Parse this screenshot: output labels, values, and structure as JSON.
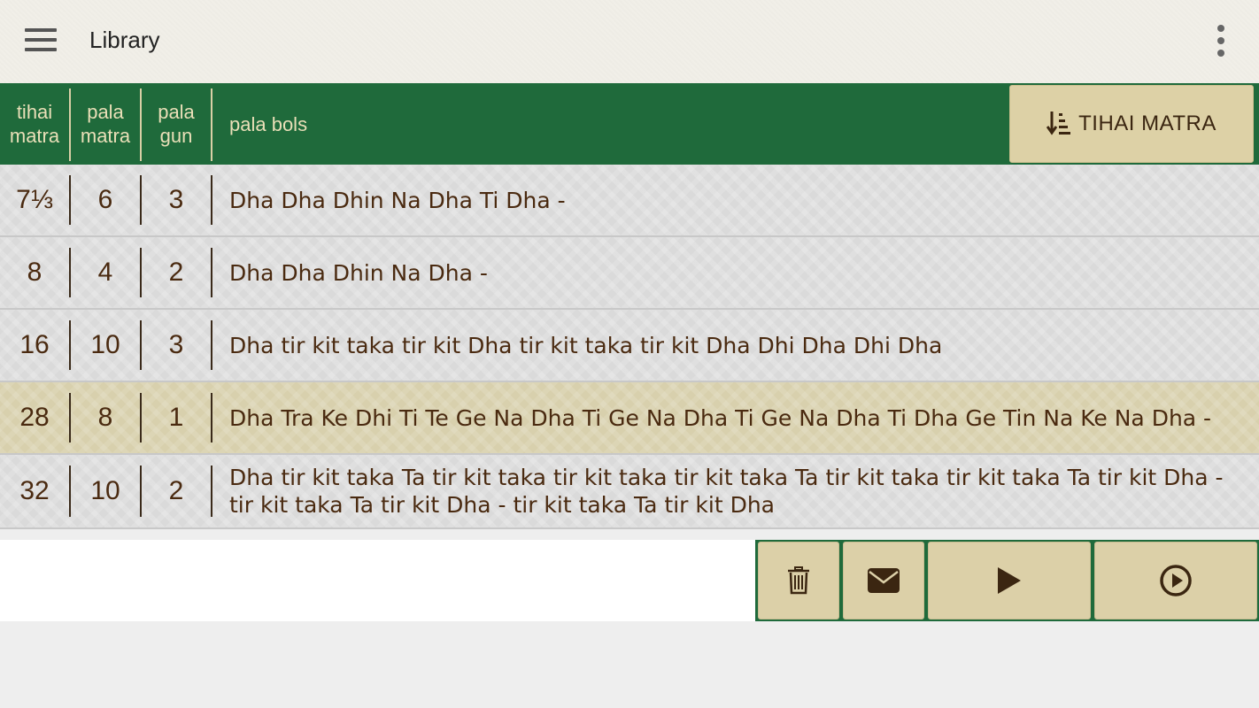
{
  "app_bar": {
    "title": "Library",
    "menu_icon": "hamburger-menu-icon",
    "overflow_icon": "more-vert-icon"
  },
  "table": {
    "headers": {
      "tihai_matra": "tihai\nmatra",
      "pala_matra": "pala\nmatra",
      "pala_gun": "pala\ngun",
      "pala_bols": "pala bols"
    },
    "sort_button": {
      "label": "TIHAI MATRA",
      "icon": "sort-ascending-icon"
    },
    "rows": [
      {
        "tihai_matra": "7⅓",
        "pala_matra": "6",
        "pala_gun": "3",
        "pala_bols": "Dha Dha Dhin Na Dha Ti Dha -",
        "selected": false
      },
      {
        "tihai_matra": "8",
        "pala_matra": "4",
        "pala_gun": "2",
        "pala_bols": "Dha Dha Dhin Na Dha -",
        "selected": false
      },
      {
        "tihai_matra": "16",
        "pala_matra": "10",
        "pala_gun": "3",
        "pala_bols": "Dha tir kit taka tir kit Dha tir kit taka tir kit Dha Dhi Dha Dhi Dha",
        "selected": false
      },
      {
        "tihai_matra": "28",
        "pala_matra": "8",
        "pala_gun": "1",
        "pala_bols": "Dha Tra Ke Dhi Ti Te Ge Na Dha Ti Ge Na Dha Ti Ge Na Dha Ti Dha Ge Tin Na Ke Na Dha -",
        "selected": true
      },
      {
        "tihai_matra": "32",
        "pala_matra": "10",
        "pala_gun": "2",
        "pala_bols": "Dha tir kit taka Ta tir kit taka tir kit taka tir kit taka Ta tir kit taka tir kit taka Ta tir kit Dha - tir kit taka Ta tir kit Dha - tir kit taka Ta tir kit Dha",
        "selected": false
      }
    ]
  },
  "toolbar": {
    "buttons": [
      {
        "name": "delete-button",
        "icon": "trash-icon"
      },
      {
        "name": "email-button",
        "icon": "envelope-icon"
      },
      {
        "name": "play-button",
        "icon": "play-icon"
      },
      {
        "name": "play-circle-button",
        "icon": "play-circle-icon"
      }
    ]
  },
  "colors": {
    "header_green": "#1f6a3b",
    "header_text": "#eadfb8",
    "button_tan": "#dcd0a8",
    "row_text": "#4a2a10",
    "selected_row": "#d8d0ad"
  }
}
